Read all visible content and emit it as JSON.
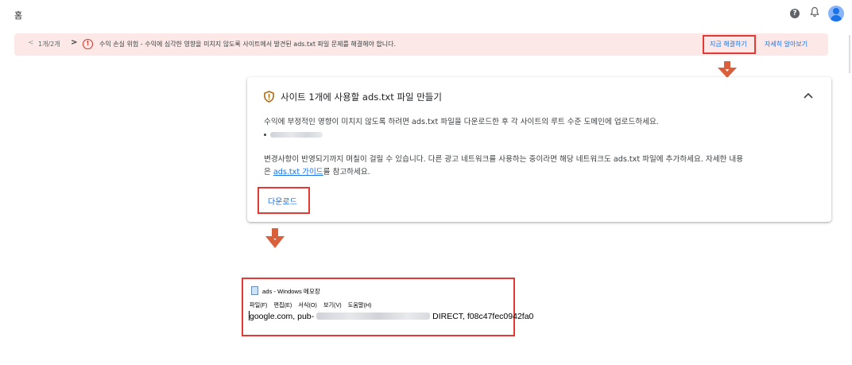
{
  "header": {
    "breadcrumb_home": "홈",
    "help_icon": "help-circle-icon",
    "notifications_icon": "bell-icon",
    "account_icon": "avatar-icon"
  },
  "alert": {
    "count": "1개/2개",
    "message": "수익 손실 위험 - 수익에 심각한 영향을 미치지 않도록 사이트에서 발견된 ads.txt 파일 문제를 해결해야 합니다.",
    "fix_now": "지금 해결하기",
    "learn_more": "자세히 알아보기",
    "icon": "error-circle-icon"
  },
  "card": {
    "title": "사이트 1개에 사용할 ads.txt 파일 만들기",
    "description": "수익에 부정적인 영향이 미치지 않도록 하려면 ads.txt 파일을 다운로드한 후 각 사이트의 루트 수준 도메인에 업로드하세요.",
    "note_line1": "변경사항이 반영되기까지 며칠이 걸릴 수 있습니다. 다른 광고 네트워크를 사용하는 중이라면 해당 네트워크도 ads.txt 파일에 추가하세요. 자세한 내용",
    "note_prefix": "은 ",
    "guide_link": "ads.txt 가이드",
    "note_suffix": "를 참고하세요.",
    "download": "다운로드"
  },
  "notepad": {
    "window_title": "ads - Windows 메모장",
    "menu": [
      "파일(F)",
      "편집(E)",
      "서식(O)",
      "보기(V)",
      "도움말(H)"
    ],
    "content_prefix": "google.com, pub-",
    "content_suffix": "DIRECT, f08c47fec0942fa0"
  },
  "colors": {
    "annotation_red": "#e53935",
    "arrow_orange": "#d9603b",
    "link_blue": "#1a73e8",
    "alert_bg": "#fce8e6"
  }
}
